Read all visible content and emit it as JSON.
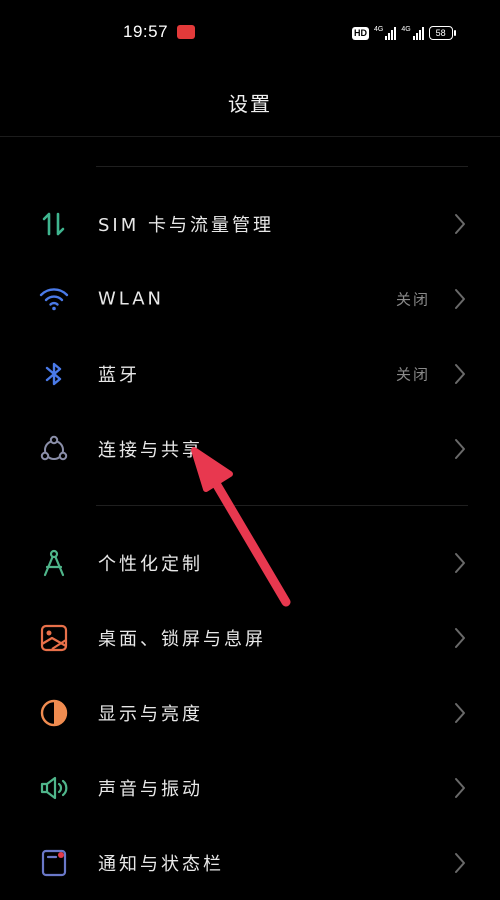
{
  "status_bar": {
    "time": "19:57",
    "hd_label": "HD",
    "signal1_label": "4G",
    "signal2_label": "4G",
    "battery": "58"
  },
  "header": {
    "title": "设置"
  },
  "settings": [
    {
      "label": "SIM 卡与流量管理",
      "value": "",
      "icon": "sim-data-icon",
      "color": "#3fb58f"
    },
    {
      "label": "WLAN",
      "value": "关闭",
      "icon": "wifi-icon",
      "color": "#4a7ae8"
    },
    {
      "label": "蓝牙",
      "value": "关闭",
      "icon": "bluetooth-icon",
      "color": "#4a7ae8"
    },
    {
      "label": "连接与共享",
      "value": "",
      "icon": "connection-share-icon",
      "color": "#8a8ea8"
    },
    {
      "label": "个性化定制",
      "value": "",
      "icon": "personalization-icon",
      "color": "#4fb58a"
    },
    {
      "label": "桌面、锁屏与息屏",
      "value": "",
      "icon": "wallpaper-icon",
      "color": "#e8704a"
    },
    {
      "label": "显示与亮度",
      "value": "",
      "icon": "display-brightness-icon",
      "color": "#f08c50"
    },
    {
      "label": "声音与振动",
      "value": "",
      "icon": "sound-vibration-icon",
      "color": "#4fb58a"
    },
    {
      "label": "通知与状态栏",
      "value": "",
      "icon": "notification-icon",
      "color": "#6a78c8"
    }
  ],
  "annotation": {
    "arrow_color": "#e8384f"
  }
}
